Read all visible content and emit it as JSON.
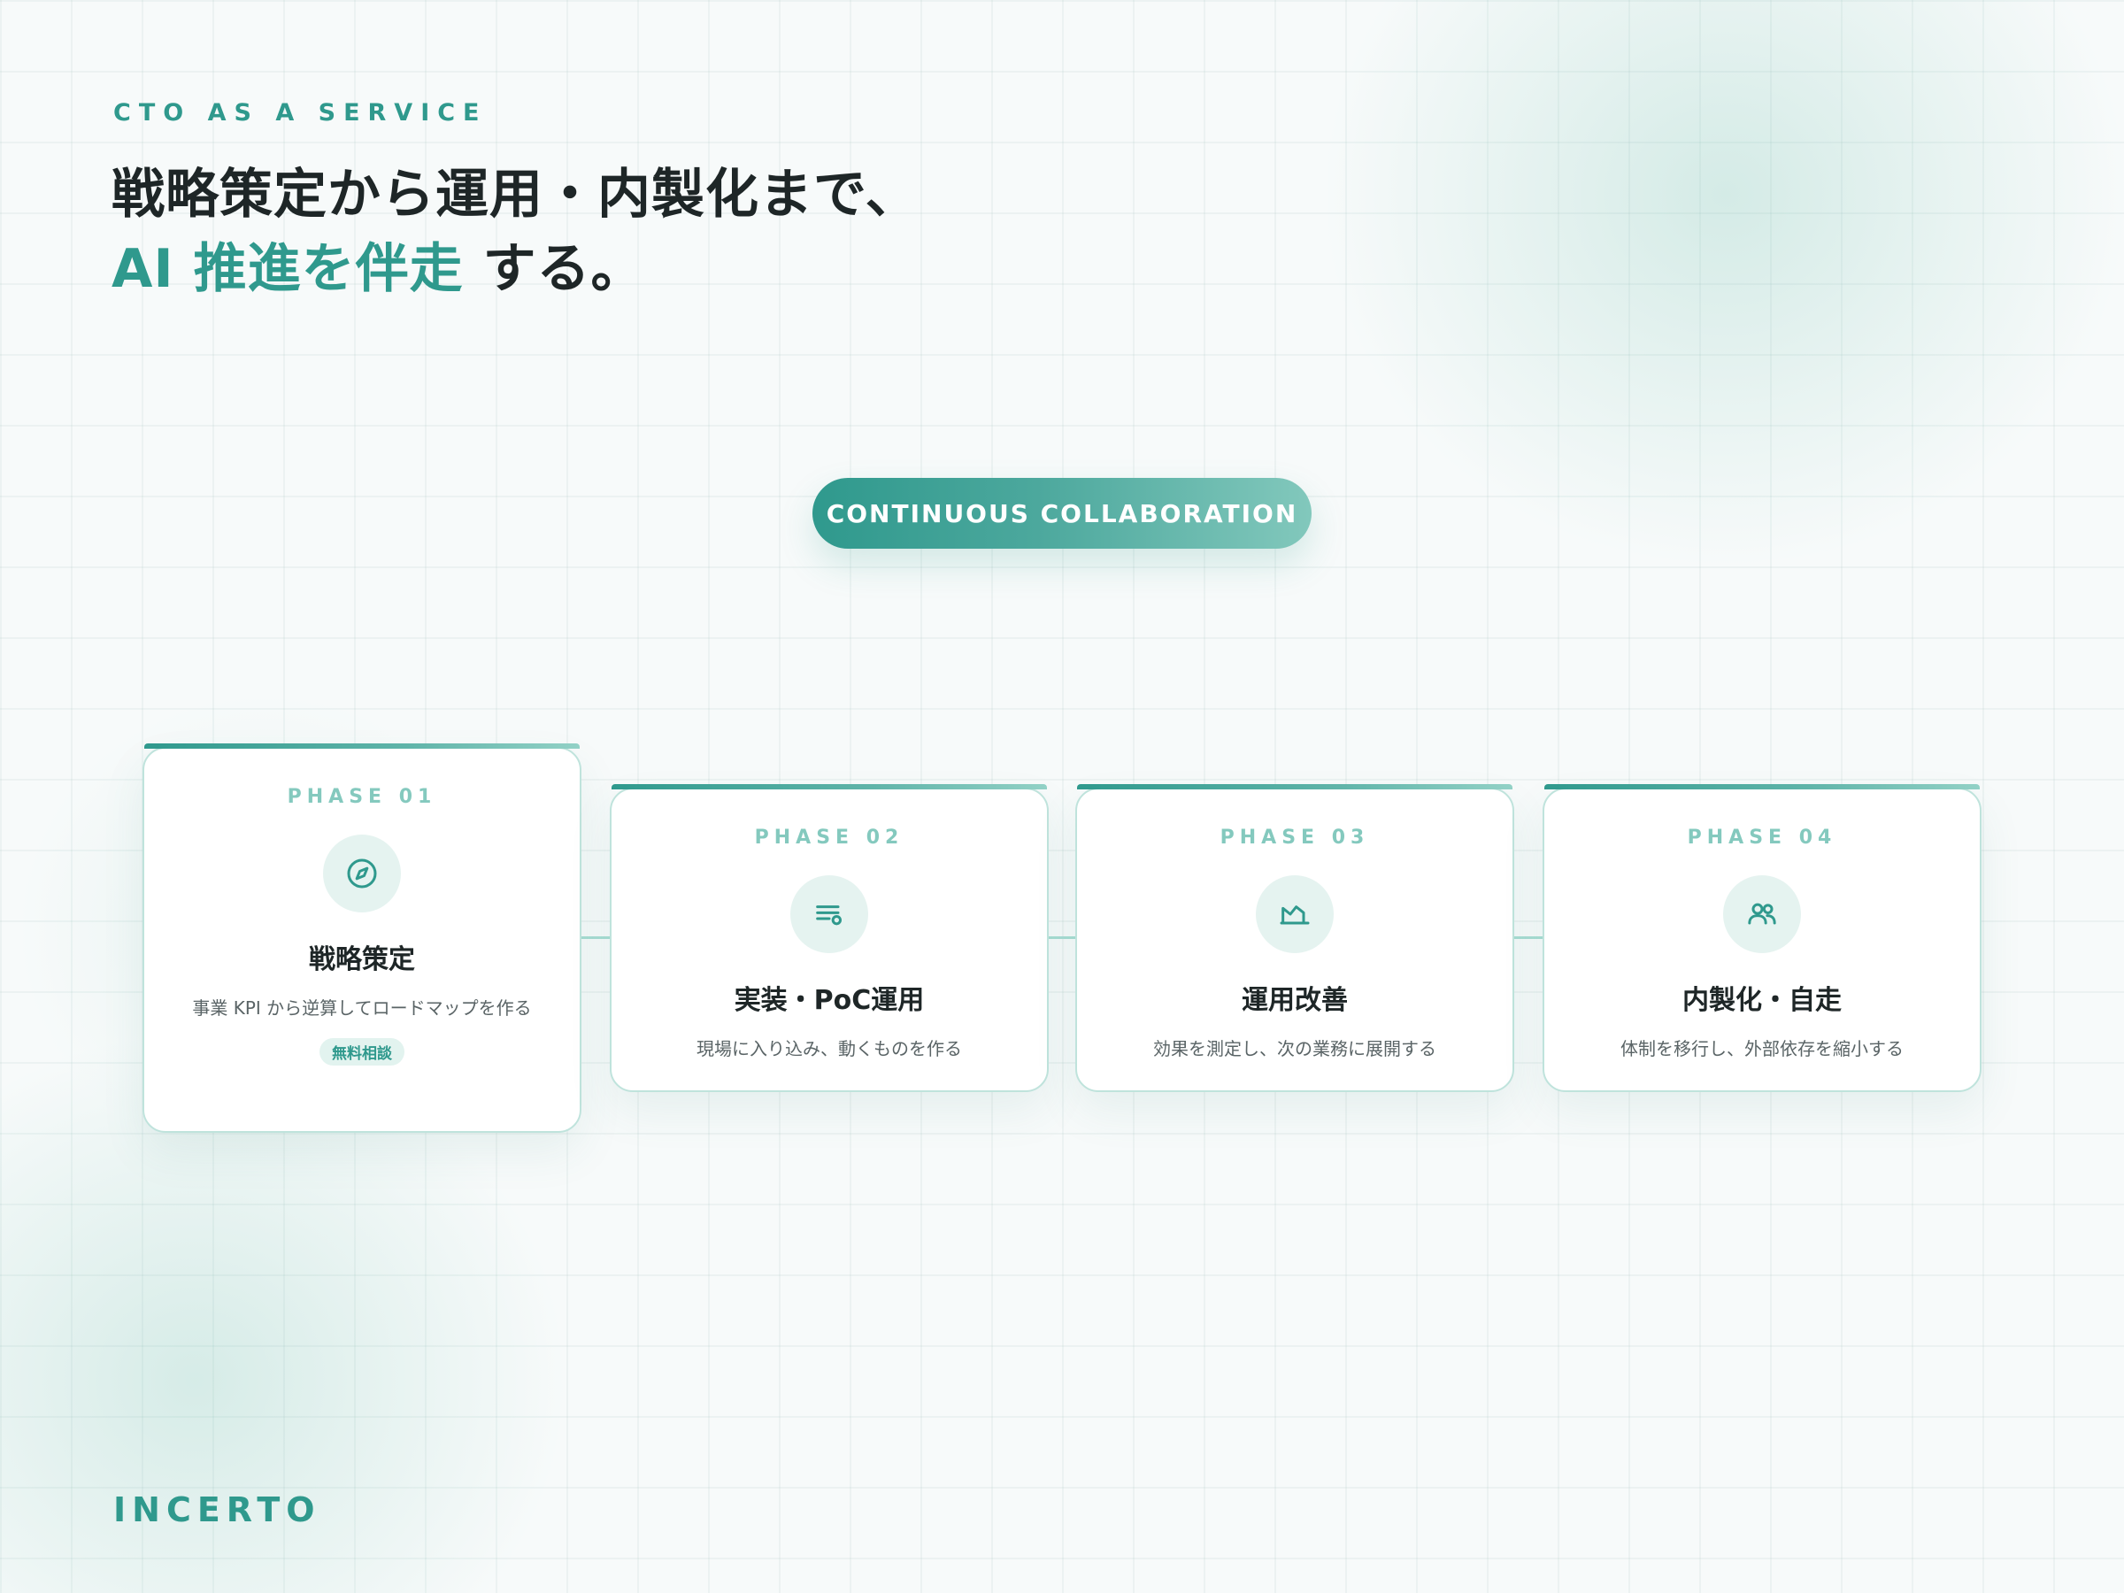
{
  "header": {
    "eyebrow": "CTO AS A SERVICE",
    "headline_line1": "戦略策定から運用・内製化まで、",
    "headline_accent": "AI 推進を伴走",
    "headline_tail": " する。"
  },
  "pill": {
    "label": "CONTINUOUS COLLABORATION"
  },
  "phases": [
    {
      "label": "PHASE 01",
      "icon": "compass-icon",
      "title": "戦略策定",
      "description": "事業 KPI から逆算してロードマップを作る",
      "badge": "無料相談"
    },
    {
      "label": "PHASE 02",
      "icon": "list-settings-icon",
      "title": "実装・PoC運用",
      "description": "現場に入り込み、動くものを作る"
    },
    {
      "label": "PHASE 03",
      "icon": "chart-area-icon",
      "title": "運用改善",
      "description": "効果を測定し、次の業務に展開する"
    },
    {
      "label": "PHASE 04",
      "icon": "users-icon",
      "title": "内製化・自走",
      "description": "体制を移行し、外部依存を縮小する"
    }
  ],
  "footer": {
    "brand": "INCERTO"
  },
  "colors": {
    "accent": "#2f998d",
    "accent_light": "#84c9be",
    "text": "#1e2627",
    "background": "#f7fafa"
  }
}
